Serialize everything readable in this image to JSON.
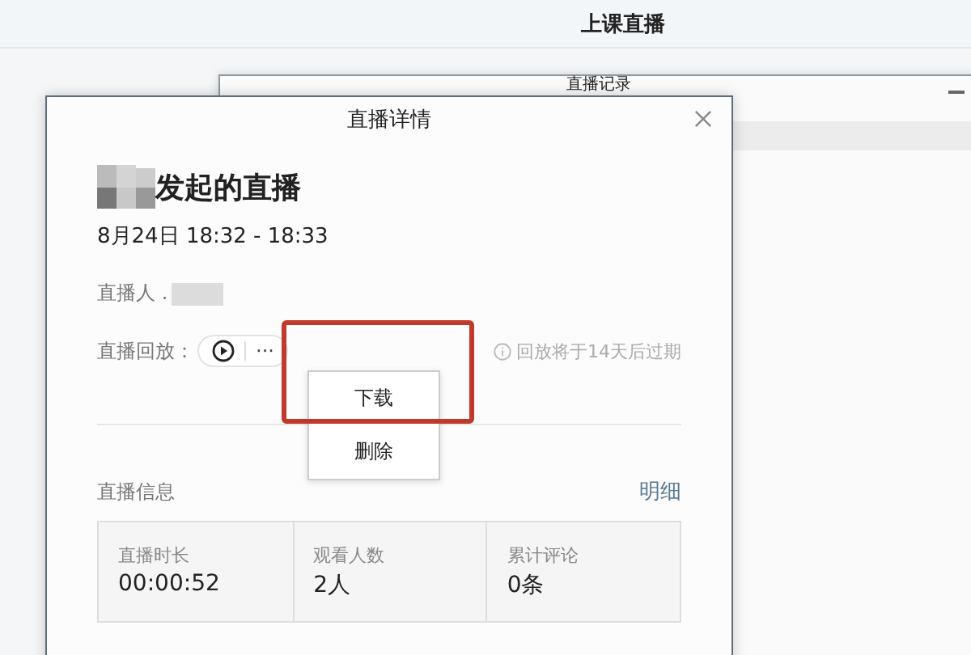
{
  "app": {
    "title": "上课直播"
  },
  "background_window": {
    "title": "直播记录"
  },
  "dialog": {
    "title": "直播详情",
    "heading": "发起的直播",
    "time": "8月24日 18:32 - 18:33",
    "host_label": "直播人 .",
    "replay_label": "直播回放：",
    "more": "···",
    "expiry_note": "回放将于14天后过期",
    "menu": [
      {
        "label": "下载",
        "highlighted": true
      },
      {
        "label": "删除",
        "highlighted": false
      }
    ],
    "info_title": "直播信息",
    "details_link": "明细",
    "stats": [
      {
        "label": "直播时长",
        "value": "00:00:52"
      },
      {
        "label": "观看人数",
        "value": "2人"
      },
      {
        "label": "累计评论",
        "value": "0条"
      }
    ]
  }
}
